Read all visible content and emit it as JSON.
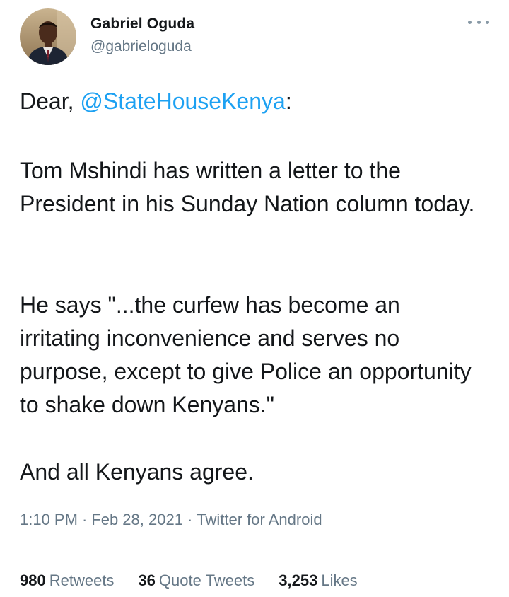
{
  "author": {
    "name": "Gabriel Oguda",
    "handle": "@gabrieloguda"
  },
  "tweet": {
    "p1_prefix": "Dear, ",
    "p1_mention": "@StateHouseKenya",
    "p1_suffix": ":",
    "p2": "Tom Mshindi has written a letter to the President in his Sunday Nation column today.",
    "p3": "He says \"...the curfew has become an irritating inconvenience and serves no purpose, except to give Police an opportunity to shake down Kenyans.\"",
    "p4": "And all Kenyans agree."
  },
  "meta": {
    "time": "1:10 PM",
    "date": "Feb 28, 2021",
    "source": "Twitter for Android",
    "separator": "·"
  },
  "stats": {
    "retweets_count": "980",
    "retweets_label": "Retweets",
    "quotes_count": "36",
    "quotes_label": "Quote Tweets",
    "likes_count": "3,253",
    "likes_label": "Likes"
  },
  "colors": {
    "link": "#1da1f2",
    "secondary_text": "#657786",
    "primary_text": "#14171a"
  },
  "icons": {
    "more": "more-options-icon"
  }
}
